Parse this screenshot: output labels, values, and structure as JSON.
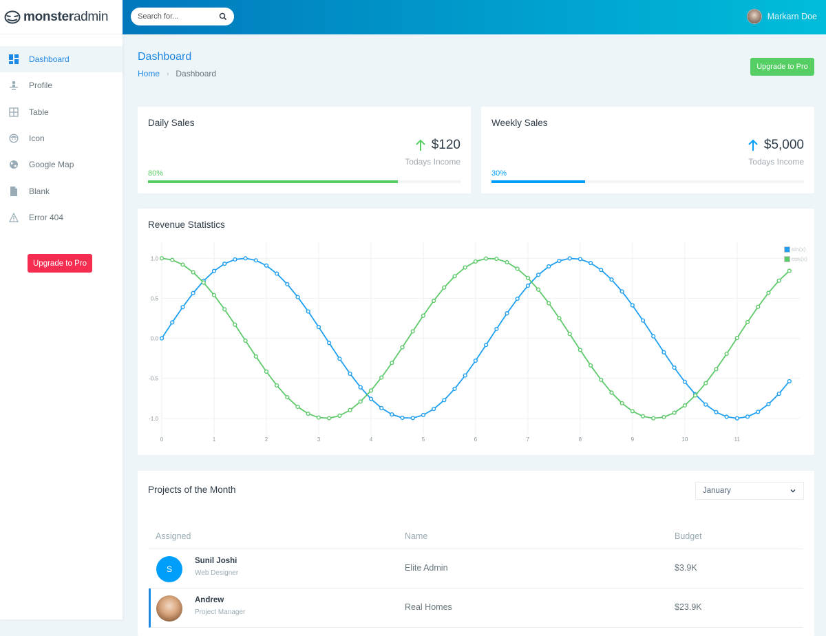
{
  "brand": {
    "bold": "monster",
    "light": "admin",
    "icon": "monster-logo-icon"
  },
  "sidebar": {
    "items": [
      {
        "label": "Dashboard",
        "icon": "dashboard-icon",
        "active": true
      },
      {
        "label": "Profile",
        "icon": "profile-icon",
        "active": false
      },
      {
        "label": "Table",
        "icon": "table-icon",
        "active": false
      },
      {
        "label": "Icon",
        "icon": "smiley-icon",
        "active": false
      },
      {
        "label": "Google Map",
        "icon": "globe-icon",
        "active": false
      },
      {
        "label": "Blank",
        "icon": "file-icon",
        "active": false
      },
      {
        "label": "Error 404",
        "icon": "warning-icon",
        "active": false
      }
    ],
    "upgrade_label": "Upgrade to Pro"
  },
  "topbar": {
    "search_placeholder": "Search for...",
    "user_name": "Markarn Doe"
  },
  "header": {
    "title": "Dashboard",
    "breadcrumb": [
      "Home",
      "Dashboard"
    ],
    "upgrade_label": "Upgrade to Pro"
  },
  "colors": {
    "blue": "#1e88e5",
    "green": "#55ce63",
    "red": "#f62d51",
    "sky": "#009efb"
  },
  "stats": [
    {
      "title": "Daily Sales",
      "value": "$120",
      "sublabel": "Todays Income",
      "percent_label": "80%",
      "progress": 0.8,
      "color": "#55ce63"
    },
    {
      "title": "Weekly Sales",
      "value": "$5,000",
      "sublabel": "Todays Income",
      "percent_label": "30%",
      "progress": 0.3,
      "color": "#009efb"
    }
  ],
  "revenue": {
    "title": "Revenue Statistics"
  },
  "chart_data": {
    "type": "line",
    "title": "Revenue Statistics",
    "xlabel": "",
    "ylabel": "",
    "x_start": 0,
    "x_step": 0.2,
    "x_count": 61,
    "xlim": [
      0,
      12.2
    ],
    "ylim": [
      -1.2,
      1.2
    ],
    "xticks": [
      "0",
      "1",
      "2",
      "3",
      "4",
      "5",
      "6",
      "7",
      "8",
      "9",
      "10",
      "11"
    ],
    "yticks": [
      "1.0",
      "0.5",
      "0.0",
      "-0.5",
      "-1.0"
    ],
    "ytick_values": [
      1.0,
      0.5,
      0.0,
      -0.5,
      -1.0
    ],
    "grid": true,
    "legend_position": "top-right",
    "series": [
      {
        "name": "sin(x)",
        "color": "#1e9ff2",
        "func": "sin"
      },
      {
        "name": "cos(x)",
        "color": "#5ec96a",
        "func": "cos"
      }
    ]
  },
  "projects": {
    "title": "Projects of the Month",
    "month_selected": "January",
    "columns": [
      "Assigned",
      "Name",
      "Budget"
    ],
    "rows": [
      {
        "initial": "S",
        "name": "Sunil Joshi",
        "role": "Web Designer",
        "project": "Elite Admin",
        "budget": "$3.9K",
        "avatar_type": "initial"
      },
      {
        "initial": "",
        "name": "Andrew",
        "role": "Project Manager",
        "project": "Real Homes",
        "budget": "$23.9K",
        "avatar_type": "photo"
      }
    ]
  }
}
